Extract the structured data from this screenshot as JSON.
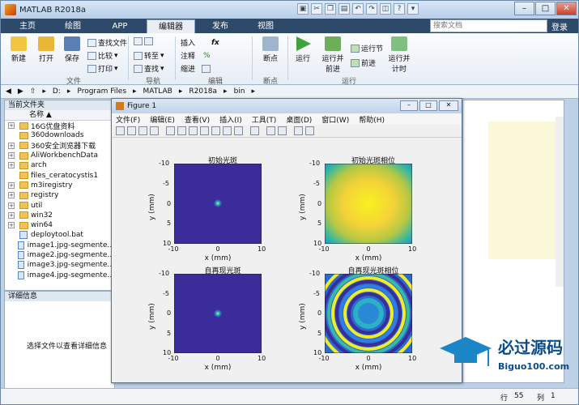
{
  "app": {
    "title": "MATLAB R2018a"
  },
  "tabs": [
    "主页",
    "绘图",
    "APP",
    "编辑器",
    "发布",
    "视图"
  ],
  "search": {
    "placeholder": "搜索文档"
  },
  "login": "登录",
  "ribbon": {
    "new": "新建",
    "open": "打开",
    "save": "保存",
    "find_files": "查找文件",
    "compare": "比较",
    "print": "打印",
    "goto": "转至",
    "find": "查找",
    "insert": "插入",
    "comment": "注释",
    "indent": "缩进",
    "breakpoints": "断点",
    "run": "运行",
    "run_advance": "运行并\n前进",
    "run_section": "运行节",
    "advance": "前进",
    "run_time": "运行并\n计时",
    "groups": {
      "file": "文件",
      "navigate": "导航",
      "edit": "编辑",
      "breakpoints": "断点",
      "run": "运行"
    }
  },
  "address": [
    "D:",
    "Program Files",
    "MATLAB",
    "R2018a",
    "bin"
  ],
  "current_folder": {
    "title": "当前文件夹",
    "column": "名称 ▲",
    "items": [
      {
        "name": "16G优盘资料",
        "type": "folder",
        "expand": true
      },
      {
        "name": "360downloads",
        "type": "folder",
        "expand": false
      },
      {
        "name": "360安全浏览器下载",
        "type": "folder",
        "expand": true
      },
      {
        "name": "AliWorkbenchData",
        "type": "folder",
        "expand": true
      },
      {
        "name": "arch",
        "type": "folder",
        "expand": true
      },
      {
        "name": "files_ceratocystis1",
        "type": "folder",
        "expand": false
      },
      {
        "name": "m3iregistry",
        "type": "folder",
        "expand": true
      },
      {
        "name": "registry",
        "type": "folder",
        "expand": true
      },
      {
        "name": "util",
        "type": "folder",
        "expand": true
      },
      {
        "name": "win32",
        "type": "folder",
        "expand": true
      },
      {
        "name": "win64",
        "type": "folder",
        "expand": true
      },
      {
        "name": "deploytool.bat",
        "type": "file",
        "expand": false
      },
      {
        "name": "image1.jpg-segmente...",
        "type": "file",
        "expand": false
      },
      {
        "name": "image2.jpg-segmente...",
        "type": "file",
        "expand": false
      },
      {
        "name": "image3.jpg-segmente...",
        "type": "file",
        "expand": false
      },
      {
        "name": "image4.jpg-segmente...",
        "type": "file",
        "expand": false
      }
    ]
  },
  "details": {
    "title": "详细信息",
    "message": "选择文件以查看详细信息"
  },
  "status": {
    "row_label": "行",
    "row": "55",
    "col_label": "列",
    "col": "1"
  },
  "figure": {
    "title": "Figure 1",
    "menu": [
      "文件(F)",
      "编辑(E)",
      "查看(V)",
      "插入(I)",
      "工具(T)",
      "桌面(D)",
      "窗口(W)",
      "帮助(H)"
    ],
    "plots": [
      {
        "title": "初始光斑",
        "xlabel": "x (mm)",
        "ylabel": "y (mm)"
      },
      {
        "title": "初始光斑相位",
        "xlabel": "x (mm)",
        "ylabel": "y (mm)"
      },
      {
        "title": "自再现光斑",
        "xlabel": "x (mm)",
        "ylabel": "y (mm)"
      },
      {
        "title": "自再现光斑相位",
        "xlabel": "x (mm)",
        "ylabel": "y (mm)"
      }
    ],
    "xticks": [
      "-10",
      "0",
      "10"
    ],
    "yticks": [
      "-10",
      "-5",
      "0",
      "5",
      "10"
    ]
  },
  "watermark": {
    "text": "必过源码",
    "url": "Biguo100.com"
  }
}
